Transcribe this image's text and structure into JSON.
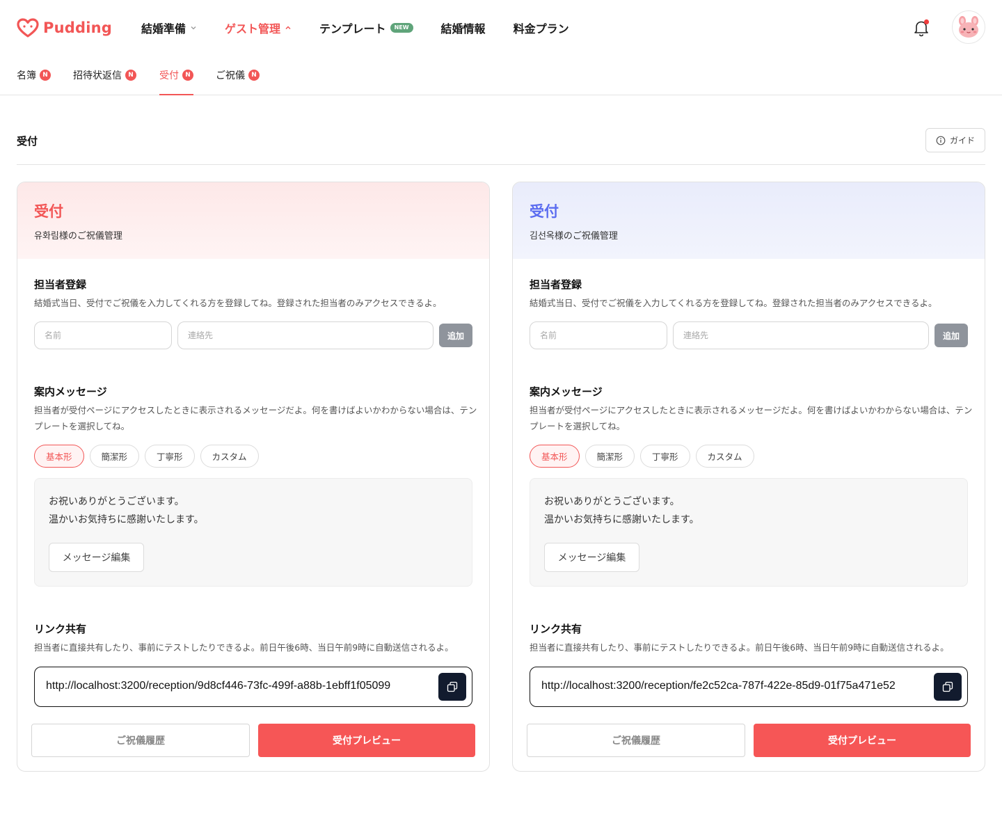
{
  "brand": {
    "name": "Pudding",
    "color": "#f25656"
  },
  "main_nav": {
    "items": [
      {
        "label": "結婚準備",
        "has_dropdown": true
      },
      {
        "label": "ゲスト管理",
        "has_dropdown": true,
        "active": true
      },
      {
        "label": "テンプレート",
        "badge": "NEW"
      },
      {
        "label": "結婚情報"
      },
      {
        "label": "料金プラン"
      }
    ]
  },
  "sub_nav": {
    "items": [
      {
        "label": "名簿",
        "badge": "N"
      },
      {
        "label": "招待状返信",
        "badge": "N"
      },
      {
        "label": "受付",
        "badge": "N",
        "active": true
      },
      {
        "label": "ご祝儀",
        "badge": "N"
      }
    ]
  },
  "page": {
    "title": "受付",
    "guide_label": "ガイド"
  },
  "cards": [
    {
      "title": "受付",
      "subtitle": "유화림様のご祝儀管理",
      "accent": "#f25656",
      "staff": {
        "title": "担当者登録",
        "desc": "結婚式当日、受付でご祝儀を入力してくれる方を登録してね。登録された担当者のみアクセスできるよ。",
        "name_placeholder": "名前",
        "contact_placeholder": "連絡先",
        "add_label": "追加"
      },
      "message": {
        "title": "案内メッセージ",
        "desc": "担当者が受付ページにアクセスしたときに表示されるメッセージだよ。何を書けばよいかわからない場合は、テンプレートを選択してね。",
        "templates": [
          "基本形",
          "簡潔形",
          "丁寧形",
          "カスタム"
        ],
        "selected_template": "基本形",
        "body": "お祝いありがとうございます。\n温かいお気持ちに感謝いたします。",
        "edit_label": "メッセージ編集"
      },
      "link": {
        "title": "リンク共有",
        "desc": "担当者に直接共有したり、事前にテストしたりできるよ。前日午後6時、当日午前9時に自動送信されるよ。",
        "url": "http://localhost:3200/reception/9d8cf446-73fc-499f-a88b-1ebff1f05099"
      },
      "history_label": "ご祝儀履歴",
      "preview_label": "受付プレビュー"
    },
    {
      "title": "受付",
      "subtitle": "김선옥様のご祝儀管理",
      "accent": "#5b6cf0",
      "staff": {
        "title": "担当者登録",
        "desc": "結婚式当日、受付でご祝儀を入力してくれる方を登録してね。登録された担当者のみアクセスできるよ。",
        "name_placeholder": "名前",
        "contact_placeholder": "連絡先",
        "add_label": "追加"
      },
      "message": {
        "title": "案内メッセージ",
        "desc": "担当者が受付ページにアクセスしたときに表示されるメッセージだよ。何を書けばよいかわからない場合は、テンプレートを選択してね。",
        "templates": [
          "基本形",
          "簡潔形",
          "丁寧形",
          "カスタム"
        ],
        "selected_template": "基本形",
        "body": "お祝いありがとうございます。\n温かいお気持ちに感謝いたします。",
        "edit_label": "メッセージ編集"
      },
      "link": {
        "title": "リンク共有",
        "desc": "担当者に直接共有したり、事前にテストしたりできるよ。前日午後6時、当日午前9時に自動送信されるよ。",
        "url": "http://localhost:3200/reception/fe2c52ca-787f-422e-85d9-01f75a471e52"
      },
      "history_label": "ご祝儀履歴",
      "preview_label": "受付プレビュー"
    }
  ],
  "icons": {
    "logo": "heart-logo-icon",
    "bell": "bell-icon",
    "avatar": "bunny-avatar-icon",
    "info": "info-icon",
    "copy": "copy-icon",
    "chevron_down": "chevron-down-icon",
    "chevron_up": "chevron-up-icon"
  }
}
